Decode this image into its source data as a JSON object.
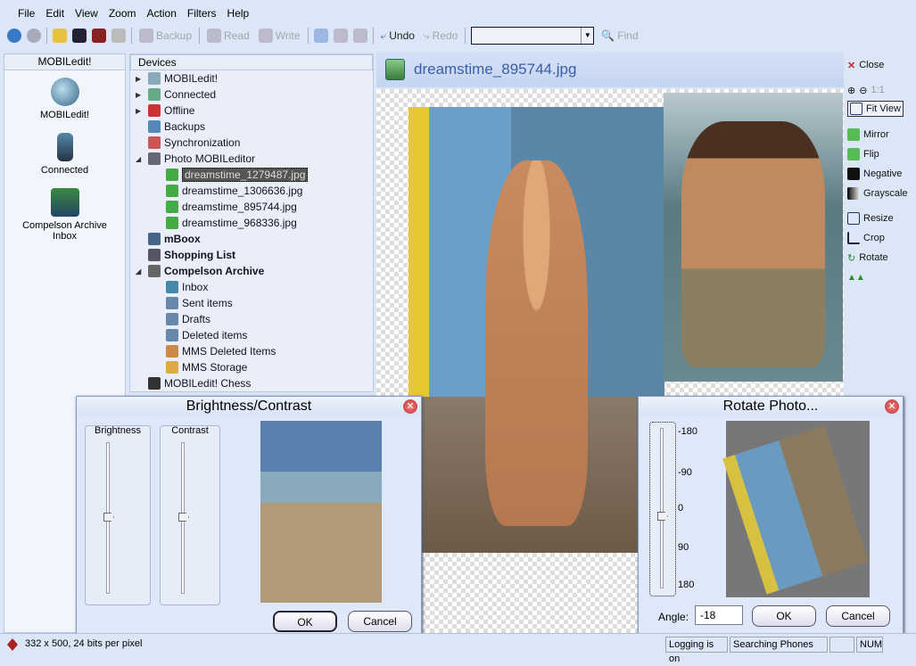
{
  "menu": [
    "File",
    "Edit",
    "View",
    "Zoom",
    "Action",
    "Filters",
    "Help"
  ],
  "toolbar": {
    "backup": "Backup",
    "read": "Read",
    "write": "Write",
    "undo": "Undo",
    "redo": "Redo",
    "find": "Find",
    "combo_value": ""
  },
  "left_panel": {
    "title": "MOBILedit!",
    "items": [
      {
        "label": "MOBILedit!"
      },
      {
        "label": "Connected"
      },
      {
        "label": "Compelson Archive Inbox"
      }
    ]
  },
  "devices": {
    "title": "Devices",
    "nodes": [
      {
        "label": "MOBILedit!",
        "level": 0,
        "expander": "right"
      },
      {
        "label": "Connected",
        "level": 0,
        "expander": "right"
      },
      {
        "label": "Offline",
        "level": 0,
        "expander": "right"
      },
      {
        "label": "Backups",
        "level": 0
      },
      {
        "label": "Synchronization",
        "level": 0
      },
      {
        "label": "Photo MOBILeditor",
        "level": 0,
        "expander": "down"
      },
      {
        "label": "dreamstime_1279487.jpg",
        "level": 1,
        "selected": true
      },
      {
        "label": "dreamstime_1306636.jpg",
        "level": 1
      },
      {
        "label": "dreamstime_895744.jpg",
        "level": 1
      },
      {
        "label": "dreamstime_968336.jpg",
        "level": 1
      },
      {
        "label": "mBoox",
        "level": 0,
        "bold": true
      },
      {
        "label": "Shopping List",
        "level": 0,
        "bold": true
      },
      {
        "label": "Compelson Archive",
        "level": 0,
        "bold": true,
        "expander": "down"
      },
      {
        "label": "Inbox",
        "level": 1
      },
      {
        "label": "Sent items",
        "level": 1
      },
      {
        "label": "Drafts",
        "level": 1
      },
      {
        "label": "Deleted items",
        "level": 1
      },
      {
        "label": "MMS Deleted Items",
        "level": 1
      },
      {
        "label": "MMS Storage",
        "level": 1
      },
      {
        "label": "MOBILedit! Chess",
        "level": 0
      }
    ]
  },
  "viewer": {
    "filename": "dreamstime_895744.jpg"
  },
  "tools": {
    "close": "Close",
    "zoom_1to1": "1:1",
    "fit_view": "Fit View",
    "mirror": "Mirror",
    "flip": "Flip",
    "negative": "Negative",
    "grayscale": "Grayscale",
    "resize": "Resize",
    "crop": "Crop",
    "rotate": "Rotate"
  },
  "brightness_dialog": {
    "title": "Brightness/Contrast",
    "brightness_label": "Brightness",
    "contrast_label": "Contrast",
    "brightness_value": 0,
    "contrast_value": 0,
    "ok": "OK",
    "cancel": "Cancel"
  },
  "rotate_dialog": {
    "title": "Rotate Photo...",
    "ticks": [
      "-180",
      "-90",
      "0",
      "90",
      "180"
    ],
    "angle_label": "Angle:",
    "angle_value": "-18",
    "ok": "OK",
    "cancel": "Cancel"
  },
  "status": {
    "info": "332 x 500, 24 bits per pixel",
    "logging": "Logging is on",
    "searching": "Searching Phones",
    "num": "NUM"
  },
  "colors": {
    "accent": "#3a5fa8",
    "background": "#dbe6f7"
  }
}
